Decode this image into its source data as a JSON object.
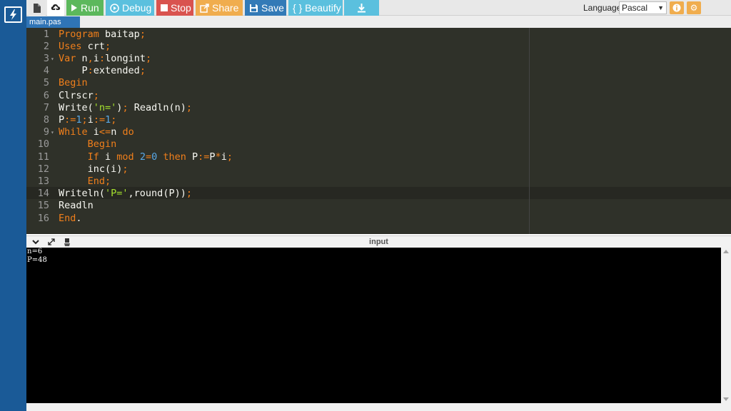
{
  "colors": {
    "rail": "#1a5a97",
    "run": "#5cb85c",
    "debug": "#5bc0de",
    "stop": "#d9534f",
    "share": "#f0ad4e",
    "save": "#337ab7",
    "editor_bg": "#2f3129",
    "keyword": "#f07f1b",
    "string": "#a6e22e",
    "number": "#5aa9e6"
  },
  "toolbar": {
    "run_label": "Run",
    "debug_label": "Debug",
    "stop_label": "Stop",
    "share_label": "Share",
    "save_label": "Save",
    "beautify_label": "{ } Beautify",
    "language_label": "Language",
    "language_value": "Pascal",
    "icons": {
      "logo": "bolt-icon",
      "file": "file-icon",
      "upload": "upload-icon",
      "run": "play-icon",
      "debug": "debug-icon",
      "stop": "stop-icon",
      "share": "share-icon",
      "save": "floppy-icon",
      "download": "download-icon",
      "info": "info-icon",
      "settings": "gear-icon"
    }
  },
  "tabs": [
    {
      "label": "main.pas"
    }
  ],
  "editor": {
    "lines": [
      {
        "n": "1",
        "fold": false,
        "tokens": [
          [
            "kw",
            "Program "
          ],
          [
            "id",
            "baitap"
          ],
          [
            "kw",
            ";"
          ]
        ]
      },
      {
        "n": "2",
        "fold": false,
        "tokens": [
          [
            "kw",
            "Uses "
          ],
          [
            "id",
            "crt"
          ],
          [
            "kw",
            ";"
          ]
        ]
      },
      {
        "n": "3",
        "fold": true,
        "tokens": [
          [
            "kw",
            "Var "
          ],
          [
            "id",
            "n"
          ],
          [
            "kw",
            ","
          ],
          [
            "id",
            "i"
          ],
          [
            "kw",
            ":"
          ],
          [
            "id",
            "longint"
          ],
          [
            "kw",
            ";"
          ]
        ]
      },
      {
        "n": "4",
        "fold": false,
        "tokens": [
          [
            "id",
            "    P"
          ],
          [
            "kw",
            ":"
          ],
          [
            "id",
            "extended"
          ],
          [
            "kw",
            ";"
          ]
        ]
      },
      {
        "n": "5",
        "fold": false,
        "tokens": [
          [
            "kw",
            "Begin"
          ]
        ]
      },
      {
        "n": "6",
        "fold": false,
        "tokens": [
          [
            "id",
            "Clrscr"
          ],
          [
            "kw",
            ";"
          ]
        ]
      },
      {
        "n": "7",
        "fold": false,
        "tokens": [
          [
            "id",
            "Write("
          ],
          [
            "str",
            "'n='"
          ],
          [
            "id",
            ")"
          ],
          [
            "kw",
            ";"
          ],
          [
            "id",
            " Readln(n)"
          ],
          [
            "kw",
            ";"
          ]
        ]
      },
      {
        "n": "8",
        "fold": false,
        "tokens": [
          [
            "id",
            "P"
          ],
          [
            "kw",
            ":="
          ],
          [
            "num",
            "1"
          ],
          [
            "kw",
            ";"
          ],
          [
            "id",
            "i"
          ],
          [
            "kw",
            ":="
          ],
          [
            "num",
            "1"
          ],
          [
            "kw",
            ";"
          ]
        ]
      },
      {
        "n": "9",
        "fold": true,
        "tokens": [
          [
            "kw",
            "While "
          ],
          [
            "id",
            "i"
          ],
          [
            "kw",
            "<="
          ],
          [
            "id",
            "n "
          ],
          [
            "kw",
            "do"
          ]
        ]
      },
      {
        "n": "10",
        "fold": false,
        "tokens": [
          [
            "kw",
            "     Begin"
          ]
        ]
      },
      {
        "n": "11",
        "fold": false,
        "tokens": [
          [
            "kw",
            "     If "
          ],
          [
            "id",
            "i "
          ],
          [
            "kw",
            "mod "
          ],
          [
            "num",
            "2"
          ],
          [
            "kw",
            "="
          ],
          [
            "num",
            "0 "
          ],
          [
            "kw",
            "then "
          ],
          [
            "id",
            "P"
          ],
          [
            "kw",
            ":="
          ],
          [
            "id",
            "P"
          ],
          [
            "kw",
            "*"
          ],
          [
            "id",
            "i"
          ],
          [
            "kw",
            ";"
          ]
        ]
      },
      {
        "n": "12",
        "fold": false,
        "tokens": [
          [
            "id",
            "     inc(i)"
          ],
          [
            "kw",
            ";"
          ]
        ]
      },
      {
        "n": "13",
        "fold": false,
        "tokens": [
          [
            "kw",
            "     End;"
          ]
        ]
      },
      {
        "n": "14",
        "fold": false,
        "tokens": [
          [
            "id",
            "Writeln("
          ],
          [
            "str",
            "'P='"
          ],
          [
            "id",
            ",round(P))"
          ],
          [
            "kw",
            ";"
          ]
        ]
      },
      {
        "n": "15",
        "fold": false,
        "tokens": [
          [
            "id",
            "Readln"
          ]
        ]
      },
      {
        "n": "16",
        "fold": false,
        "tokens": [
          [
            "kw",
            "End"
          ],
          [
            "id",
            "."
          ]
        ]
      }
    ]
  },
  "output": {
    "title": "input",
    "lines": [
      "n=6",
      "P=48"
    ]
  }
}
